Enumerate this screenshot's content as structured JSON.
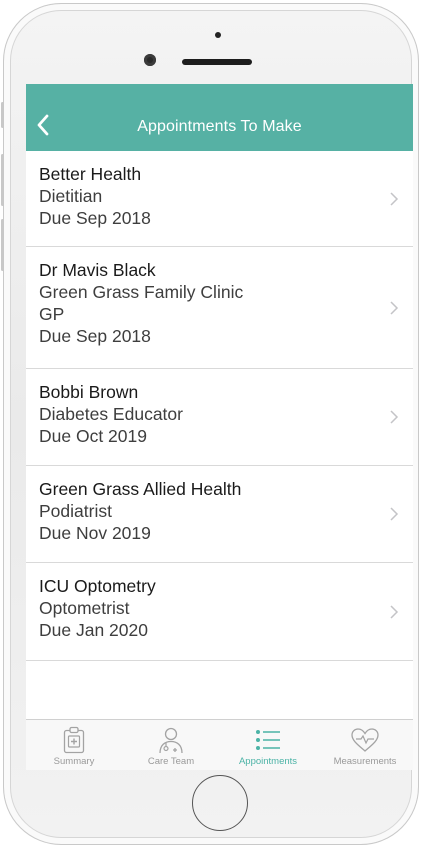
{
  "header": {
    "title": "Appointments To Make",
    "back_icon": "chevron-left-icon"
  },
  "appointments": [
    {
      "lines": [
        "Better Health",
        "Dietitian",
        "Due Sep 2018"
      ]
    },
    {
      "lines": [
        "Dr Mavis Black",
        "Green Grass Family Clinic",
        "GP",
        "Due Sep 2018"
      ]
    },
    {
      "lines": [
        "Bobbi Brown",
        "Diabetes Educator",
        "Due Oct 2019"
      ]
    },
    {
      "lines": [
        "Green Grass Allied Health",
        "Podiatrist",
        "Due Nov 2019"
      ]
    },
    {
      "lines": [
        "ICU Optometry",
        "Optometrist",
        "Due Jan 2020"
      ]
    }
  ],
  "tabs": [
    {
      "label": "Summary",
      "icon": "clipboard-medical-icon",
      "active": false
    },
    {
      "label": "Care Team",
      "icon": "doctor-icon",
      "active": false
    },
    {
      "label": "Appointments",
      "icon": "list-icon",
      "active": true
    },
    {
      "label": "Measurements",
      "icon": "heart-pulse-icon",
      "active": false
    }
  ],
  "colors": {
    "accent": "#56b1a4",
    "active_tab": "#4bb3a6",
    "inactive_tab": "#9a9a9a"
  }
}
